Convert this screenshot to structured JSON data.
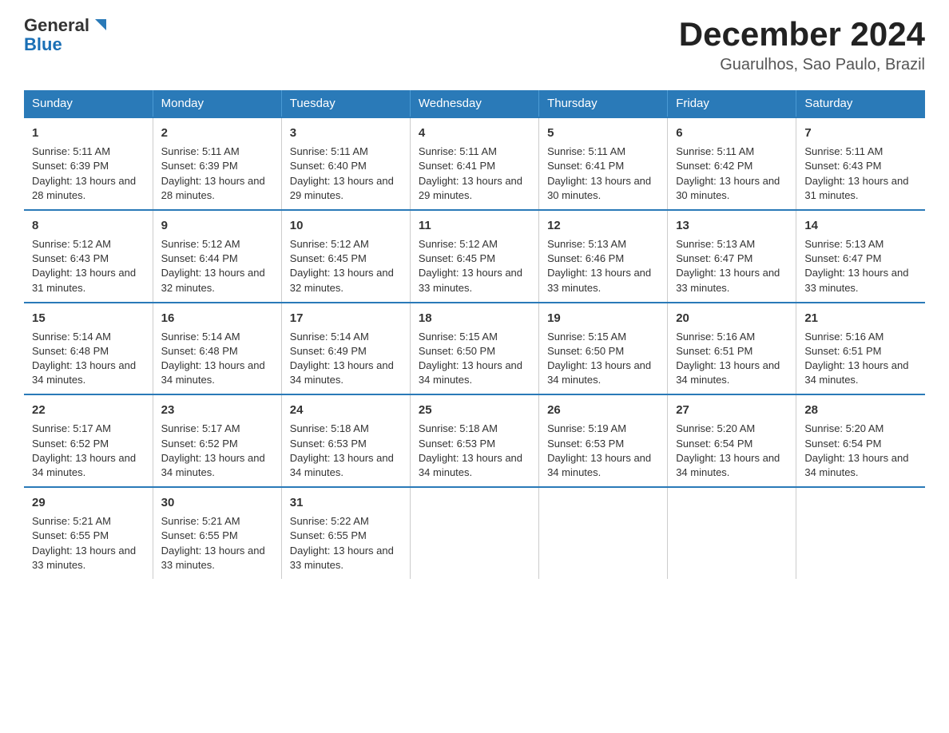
{
  "header": {
    "logo_general": "General",
    "logo_blue": "Blue",
    "title": "December 2024",
    "subtitle": "Guarulhos, Sao Paulo, Brazil"
  },
  "columns": [
    "Sunday",
    "Monday",
    "Tuesday",
    "Wednesday",
    "Thursday",
    "Friday",
    "Saturday"
  ],
  "weeks": [
    [
      {
        "day": "1",
        "sunrise": "5:11 AM",
        "sunset": "6:39 PM",
        "daylight": "13 hours and 28 minutes."
      },
      {
        "day": "2",
        "sunrise": "5:11 AM",
        "sunset": "6:39 PM",
        "daylight": "13 hours and 28 minutes."
      },
      {
        "day": "3",
        "sunrise": "5:11 AM",
        "sunset": "6:40 PM",
        "daylight": "13 hours and 29 minutes."
      },
      {
        "day": "4",
        "sunrise": "5:11 AM",
        "sunset": "6:41 PM",
        "daylight": "13 hours and 29 minutes."
      },
      {
        "day": "5",
        "sunrise": "5:11 AM",
        "sunset": "6:41 PM",
        "daylight": "13 hours and 30 minutes."
      },
      {
        "day": "6",
        "sunrise": "5:11 AM",
        "sunset": "6:42 PM",
        "daylight": "13 hours and 30 minutes."
      },
      {
        "day": "7",
        "sunrise": "5:11 AM",
        "sunset": "6:43 PM",
        "daylight": "13 hours and 31 minutes."
      }
    ],
    [
      {
        "day": "8",
        "sunrise": "5:12 AM",
        "sunset": "6:43 PM",
        "daylight": "13 hours and 31 minutes."
      },
      {
        "day": "9",
        "sunrise": "5:12 AM",
        "sunset": "6:44 PM",
        "daylight": "13 hours and 32 minutes."
      },
      {
        "day": "10",
        "sunrise": "5:12 AM",
        "sunset": "6:45 PM",
        "daylight": "13 hours and 32 minutes."
      },
      {
        "day": "11",
        "sunrise": "5:12 AM",
        "sunset": "6:45 PM",
        "daylight": "13 hours and 33 minutes."
      },
      {
        "day": "12",
        "sunrise": "5:13 AM",
        "sunset": "6:46 PM",
        "daylight": "13 hours and 33 minutes."
      },
      {
        "day": "13",
        "sunrise": "5:13 AM",
        "sunset": "6:47 PM",
        "daylight": "13 hours and 33 minutes."
      },
      {
        "day": "14",
        "sunrise": "5:13 AM",
        "sunset": "6:47 PM",
        "daylight": "13 hours and 33 minutes."
      }
    ],
    [
      {
        "day": "15",
        "sunrise": "5:14 AM",
        "sunset": "6:48 PM",
        "daylight": "13 hours and 34 minutes."
      },
      {
        "day": "16",
        "sunrise": "5:14 AM",
        "sunset": "6:48 PM",
        "daylight": "13 hours and 34 minutes."
      },
      {
        "day": "17",
        "sunrise": "5:14 AM",
        "sunset": "6:49 PM",
        "daylight": "13 hours and 34 minutes."
      },
      {
        "day": "18",
        "sunrise": "5:15 AM",
        "sunset": "6:50 PM",
        "daylight": "13 hours and 34 minutes."
      },
      {
        "day": "19",
        "sunrise": "5:15 AM",
        "sunset": "6:50 PM",
        "daylight": "13 hours and 34 minutes."
      },
      {
        "day": "20",
        "sunrise": "5:16 AM",
        "sunset": "6:51 PM",
        "daylight": "13 hours and 34 minutes."
      },
      {
        "day": "21",
        "sunrise": "5:16 AM",
        "sunset": "6:51 PM",
        "daylight": "13 hours and 34 minutes."
      }
    ],
    [
      {
        "day": "22",
        "sunrise": "5:17 AM",
        "sunset": "6:52 PM",
        "daylight": "13 hours and 34 minutes."
      },
      {
        "day": "23",
        "sunrise": "5:17 AM",
        "sunset": "6:52 PM",
        "daylight": "13 hours and 34 minutes."
      },
      {
        "day": "24",
        "sunrise": "5:18 AM",
        "sunset": "6:53 PM",
        "daylight": "13 hours and 34 minutes."
      },
      {
        "day": "25",
        "sunrise": "5:18 AM",
        "sunset": "6:53 PM",
        "daylight": "13 hours and 34 minutes."
      },
      {
        "day": "26",
        "sunrise": "5:19 AM",
        "sunset": "6:53 PM",
        "daylight": "13 hours and 34 minutes."
      },
      {
        "day": "27",
        "sunrise": "5:20 AM",
        "sunset": "6:54 PM",
        "daylight": "13 hours and 34 minutes."
      },
      {
        "day": "28",
        "sunrise": "5:20 AM",
        "sunset": "6:54 PM",
        "daylight": "13 hours and 34 minutes."
      }
    ],
    [
      {
        "day": "29",
        "sunrise": "5:21 AM",
        "sunset": "6:55 PM",
        "daylight": "13 hours and 33 minutes."
      },
      {
        "day": "30",
        "sunrise": "5:21 AM",
        "sunset": "6:55 PM",
        "daylight": "13 hours and 33 minutes."
      },
      {
        "day": "31",
        "sunrise": "5:22 AM",
        "sunset": "6:55 PM",
        "daylight": "13 hours and 33 minutes."
      },
      null,
      null,
      null,
      null
    ]
  ]
}
